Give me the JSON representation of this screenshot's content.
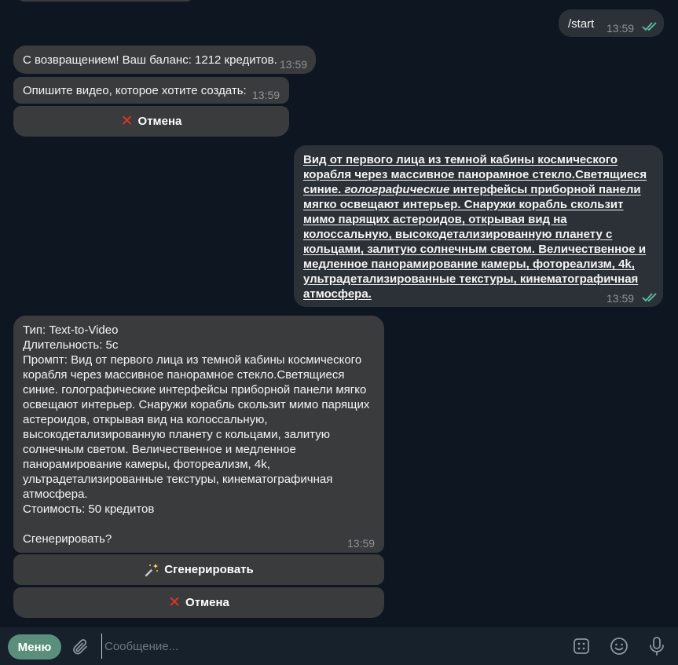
{
  "messages": {
    "start_cmd": {
      "text": "/start",
      "time": "13:59"
    },
    "welcome": {
      "text": "С возвращением! Ваш баланс: 1212 кредитов.",
      "time": "13:59"
    },
    "describe": {
      "text": "Опишите видео, которое хотите создать:",
      "time": "13:59"
    },
    "cancel_button_1": {
      "label": "Отмена"
    },
    "user_prompt": {
      "part1": "Вид от первого лица из темной кабины космического корабля через массивное панорамное стекло.Светящиеся синие.",
      "italic": "голографические",
      "part2": "интерфейсы приборной панели мягко освещают интерьер. Снаружи корабль скользит мимо парящих астероидов, открывая вид на колоссальную, высокодетализированную планету с кольцами, залитую солнечным светом. Величественное и медленное панорамирование камеры, фотореализм, 4k, ультрадетализированные текстуры, кинематографичная атмосфера.",
      "time": "13:59"
    },
    "summary": {
      "type_line": "Тип: Text-to-Video",
      "duration_line": "Длительность: 5с",
      "prompt_line": "Промпт: Вид от первого лица из темной кабины космического корабля через массивное панорамное стекло.Светящиеся синие. голографические интерфейсы приборной панели мягко освещают интерьер. Снаружи корабль скользит мимо парящих астероидов, открывая вид на колоссальную, высокодетализированную планету с кольцами, залитую солнечным светом. Величественное и медленное панорамирование камеры, фотореализм, 4k, ультрадетализированные текстуры, кинематографичная атмосфера.",
      "cost_line": "Стоимость: 50 кредитов",
      "question": "Сгенерировать?",
      "time": "13:59"
    },
    "generate_button": {
      "label": "Сгенерировать"
    },
    "cancel_button_2": {
      "label": "Отмена"
    }
  },
  "bottom_bar": {
    "menu_label": "Меню",
    "placeholder": "Сообщение..."
  },
  "icons": {
    "read": "double-check-icon",
    "cancel": "red-x-icon",
    "generate": "magic-wand-icon",
    "attach": "paperclip-icon",
    "commands": "bot-commands-icon",
    "emoji": "emoji-icon",
    "voice": "microphone-icon"
  },
  "colors": {
    "background": "#0e1621",
    "incoming_bubble": "#3a3b3d",
    "outgoing_bubble": "#2b3137",
    "accent": "#5a8f7b",
    "check": "#5fc1a2",
    "cancel_x": "#e2342b"
  }
}
